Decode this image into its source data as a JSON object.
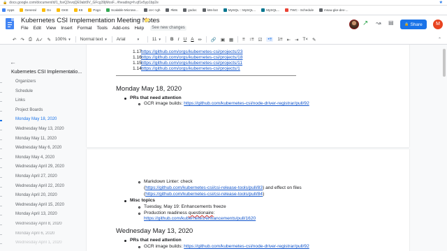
{
  "browser": {
    "url": "docs.google.com/document/d/1_fceQ3vvqQE9abt9V_GFcg39jMosF...#heading=h.qf1e5yp1bp2e",
    "bookmarks": [
      {
        "label": "Apps",
        "color": "#4285f4"
      },
      {
        "label": "General",
        "color": "#fbbc04"
      },
      {
        "label": "Go",
        "color": "#fbbc04"
      },
      {
        "label": "GKE",
        "color": "#fbbc04"
      },
      {
        "label": "K8",
        "color": "#fbbc04"
      },
      {
        "label": "Pogo",
        "color": "#fbbc04"
      },
      {
        "label": "Scalable Microse...",
        "color": "#34a853"
      },
      {
        "label": "cs<->gh",
        "color": "#5f6368"
      },
      {
        "label": "#k8s",
        "color": "#5f6368"
      },
      {
        "label": "godoc",
        "color": "#5f6368"
      },
      {
        "label": "k8s-bot",
        "color": "#5f6368"
      },
      {
        "label": "MySQL :: MySQL...",
        "color": "#00758f"
      },
      {
        "label": "MySQL...",
        "color": "#00758f"
      },
      {
        "label": "TWC - Schedule",
        "color": "#ea4335"
      },
      {
        "label": "msau-gke-dev-...",
        "color": "#5f6368"
      }
    ]
  },
  "doc": {
    "title": "Kubernetes CSI Implementation Meeting Notes",
    "menus": [
      "File",
      "Edit",
      "View",
      "Insert",
      "Format",
      "Tools",
      "Add-ons",
      "Help"
    ],
    "last_edit": "See new changes",
    "share_label": "Share",
    "user_initial": "M"
  },
  "toolbar": {
    "zoom": "100%",
    "style": "Normal text",
    "font": "Arial",
    "size": "11"
  },
  "outline": {
    "title": "Kubernetes CSI Implementatio...",
    "items": [
      {
        "label": "Organizers",
        "current": false
      },
      {
        "label": "Schedule",
        "current": false
      },
      {
        "label": "Links",
        "current": false
      },
      {
        "label": "Project Boards",
        "current": false
      },
      {
        "label": "Monday May 18, 2020",
        "current": true
      },
      {
        "label": "Wednesday May 13, 2020",
        "current": false
      },
      {
        "label": "Monday May 11, 2020",
        "current": false
      },
      {
        "label": "Wednesday May 6, 2020",
        "current": false
      },
      {
        "label": "Monday May 4, 2020",
        "current": false
      },
      {
        "label": "Wednesday April 29, 2020",
        "current": false
      },
      {
        "label": "Monday April 27, 2020",
        "current": false
      },
      {
        "label": "Wednesday April 22, 2020",
        "current": false
      },
      {
        "label": "Monday April 20, 2020",
        "current": false
      },
      {
        "label": "Wednesday April 15, 2020",
        "current": false
      },
      {
        "label": "Monday April 13, 2020",
        "current": false
      },
      {
        "label": "Wednesday April 8, 2020",
        "current": false
      },
      {
        "label": "Monday April 6, 2020",
        "current": false
      },
      {
        "label": "Wednesday April 1, 2020",
        "current": false
      }
    ]
  },
  "page1": {
    "numbered": [
      {
        "num": "1.17:",
        "link": "https://github.com/orgs/kubernetes-csi/projects/23"
      },
      {
        "num": "1.16:",
        "link": "https://github.com/orgs/kubernetes-csi/projects/18"
      },
      {
        "num": "1.15:",
        "link": "https://github.com/orgs/kubernetes-csi/projects/11"
      },
      {
        "num": "1.14:",
        "link": "https://github.com/orgs/kubernetes-csi/projects/1"
      }
    ],
    "heading": "Monday May 18, 2020",
    "prs_label": "PRs that need attention",
    "gcr_prefix": "GCR image builds: ",
    "gcr_link": "https://github.com/kubernetes-csi/node-driver-registrar/pull/92"
  },
  "page2": {
    "linter": "Markdown Linter: check",
    "linter_link1": "https://github.com/kubernetes-csi/csi-release-tools/pull/83",
    "linter_mid": ") and effect on files",
    "linter_link2": "https://github.com/kubernetes-csi/csi-release-tools/pull/84",
    "misc_label": "Misc topics",
    "misc_1": "Tuesday, May 19: Enhancements freeze",
    "misc_2_prefix": "Production readiness ",
    "misc_2_word": "questionaire",
    "misc_2_suffix": ":",
    "misc_2_link": "https://github.com/kubernetes/enhancements/pull/1620",
    "heading": "Wednesday May 13, 2020",
    "prs_label": "PRs that need attention",
    "gcr_prefix": "GCR image builds: ",
    "gcr_link": "https://github.com/kubernetes-csi/node-driver-registrar/pull/92"
  }
}
